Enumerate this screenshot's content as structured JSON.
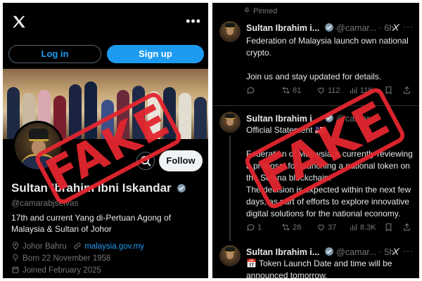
{
  "colors": {
    "accent": "#1d9bf0",
    "background": "#000000",
    "stamp": "#e3262f",
    "muted": "#71767b"
  },
  "profile": {
    "login_label": "Log in",
    "signup_label": "Sign up",
    "follow_label": "Follow",
    "name": "Sultan Ibrahim ibni Iskandar",
    "handle": "@camarabjselvas",
    "bio": "17th and current Yang di-Pertuan Agong of Malaysia & Sultan of Johor",
    "location": "Johor Bahru",
    "website": "malaysia.gov.my",
    "born": "Born 22 November 1958",
    "joined": "Joined February 2025"
  },
  "stamp_text": "FAKE",
  "tweets": [
    {
      "pinned_label": "Pinned",
      "name": "Sultan Ibrahim i...",
      "handle": "@camar...",
      "time": "· 6h",
      "text": "Federation of Malaysia launch own national crypto.\n\nJoin us and stay updated for details.",
      "reposts": "81",
      "likes": "112",
      "views": "11K"
    },
    {
      "name": "Sultan Ibrahim i...",
      "handle": "@camar...",
      "time": "",
      "text": "Official Statement 🇲🇾\n\nFederation of Malaysia is currently reviewing a proposal for launching a national token on the Solana blockchain.\nThe decision is expected within the next few days, as part of efforts to explore innovative digital solutions for the national economy.",
      "replies": "1",
      "reposts": "28",
      "likes": "37",
      "views": "8.3K"
    },
    {
      "name": "Sultan Ibrahim i...",
      "handle": "@camar...",
      "time": "· 5h",
      "text": "📅 Token Launch Date and time will be announced tomorrow."
    }
  ]
}
